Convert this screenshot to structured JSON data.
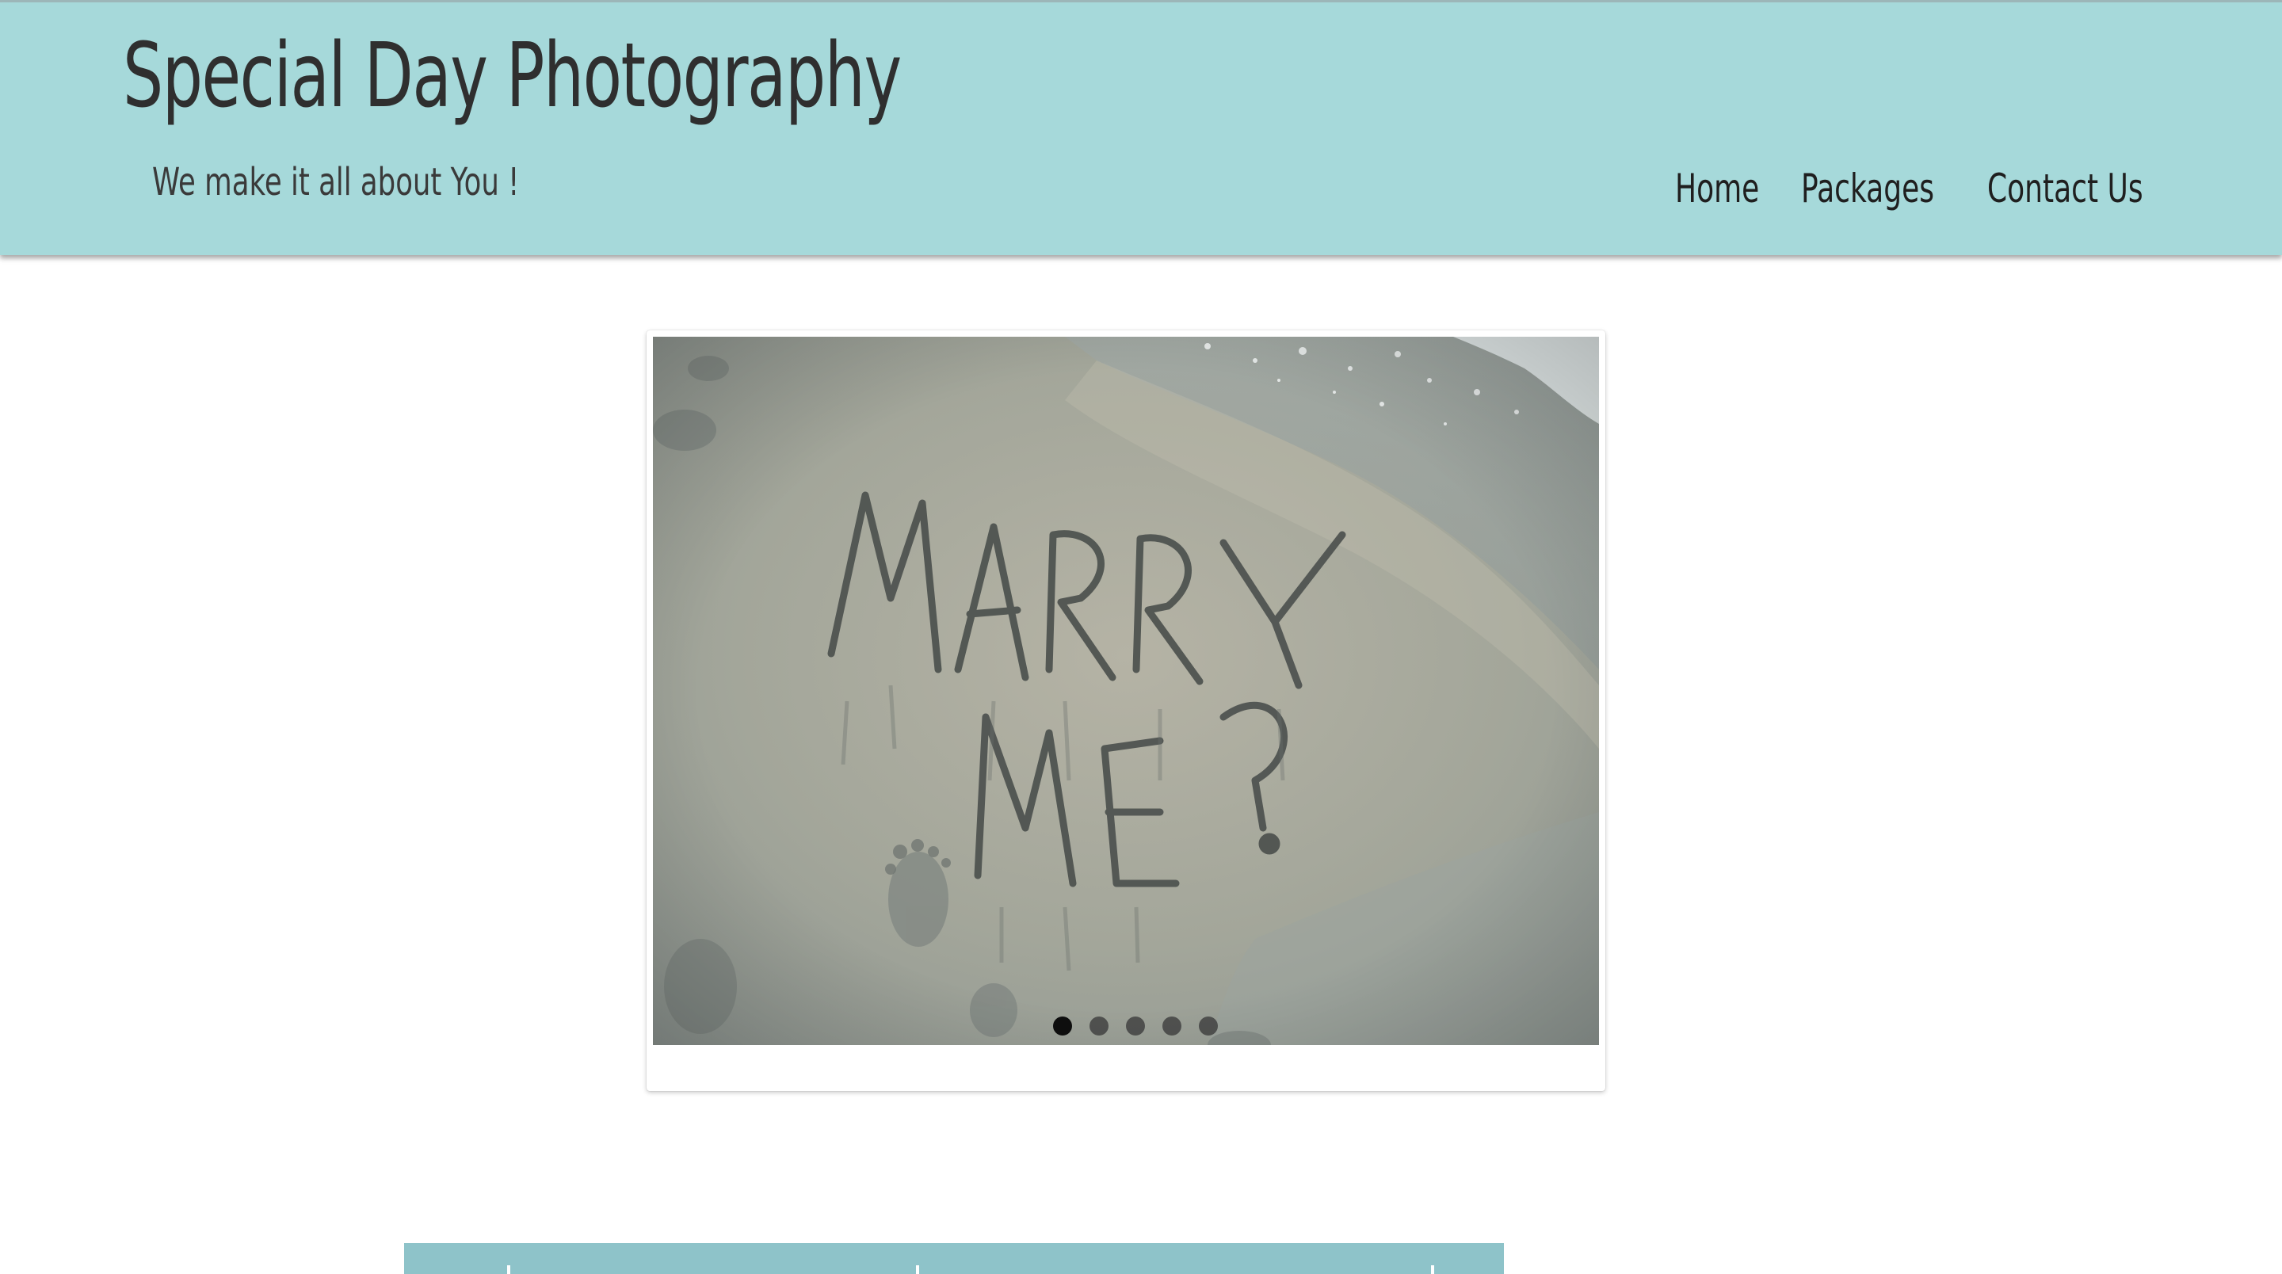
{
  "header": {
    "site_title": "Special Day Photography",
    "tagline": "We make it all about You !",
    "background_color": "#a6d9da"
  },
  "nav": {
    "items": [
      {
        "label": "Home"
      },
      {
        "label": "Packages"
      },
      {
        "label": "Contact Us"
      }
    ]
  },
  "slideshow": {
    "slide_count": 5,
    "active_slide": 1,
    "current_image": {
      "sand_text_line_1": "MARRY",
      "sand_text_line_2": "ME?"
    }
  },
  "colors": {
    "header_teal": "#a6d9da",
    "bottom_bar_teal": "#8ec3c9",
    "text_dark": "#2f2f2f"
  }
}
